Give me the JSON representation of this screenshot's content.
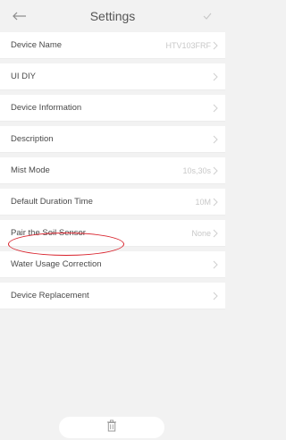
{
  "header": {
    "title": "Settings",
    "back_icon": "back-arrow-icon",
    "confirm_icon": "checkmark-icon"
  },
  "rows": [
    {
      "label": "Device Name",
      "value": "HTV103FRF"
    },
    {
      "label": "UI DIY",
      "value": ""
    },
    {
      "label": "Device Information",
      "value": ""
    },
    {
      "label": "Description",
      "value": ""
    },
    {
      "label": "Mist Mode",
      "value": "10s,30s"
    },
    {
      "label": "Default Duration Time",
      "value": "10M"
    },
    {
      "label": "Pair the Soil Sensor",
      "value": "None"
    },
    {
      "label": "Water Usage Correction",
      "value": ""
    },
    {
      "label": "Device Replacement",
      "value": ""
    }
  ],
  "footer": {
    "delete_icon": "trash-icon"
  },
  "colors": {
    "background": "#f2f2f2",
    "row": "#ffffff",
    "annotation": "#d8202a"
  }
}
